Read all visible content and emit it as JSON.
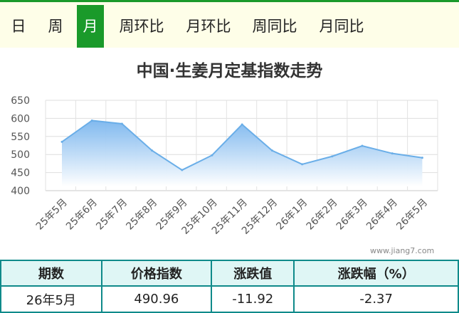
{
  "tabs": [
    {
      "label": "日",
      "active": false
    },
    {
      "label": "周",
      "active": false
    },
    {
      "label": "月",
      "active": true
    },
    {
      "label": "周环比",
      "active": false
    },
    {
      "label": "月环比",
      "active": false
    },
    {
      "label": "周同比",
      "active": false
    },
    {
      "label": "月同比",
      "active": false
    }
  ],
  "watermark": "www.jiang7.com",
  "chart_data": {
    "type": "area",
    "title": "中国·生姜月定基指数走势",
    "categories": [
      "25年5月",
      "25年6月",
      "25年7月",
      "25年8月",
      "25年9月",
      "25年10月",
      "25年11月",
      "25年12月",
      "26年1月",
      "26年2月",
      "26年3月",
      "26年4月",
      "26年5月"
    ],
    "values": [
      535,
      594,
      585,
      511,
      457,
      498,
      583,
      511,
      473,
      495,
      524,
      503,
      491
    ],
    "ylim": [
      400,
      650
    ],
    "yticks": [
      "650",
      "600",
      "550",
      "500",
      "450",
      "400"
    ],
    "grid": true,
    "line_color": "#6aaee8",
    "fill_top_color": "#7bb6ee",
    "fill_bottom_color": "#ffffff"
  },
  "table": {
    "headers": [
      "期数",
      "价格指数",
      "涨跌值",
      "涨跌幅（%）"
    ],
    "row": [
      "26年5月",
      "490.96",
      "-11.92",
      "-2.37"
    ]
  }
}
